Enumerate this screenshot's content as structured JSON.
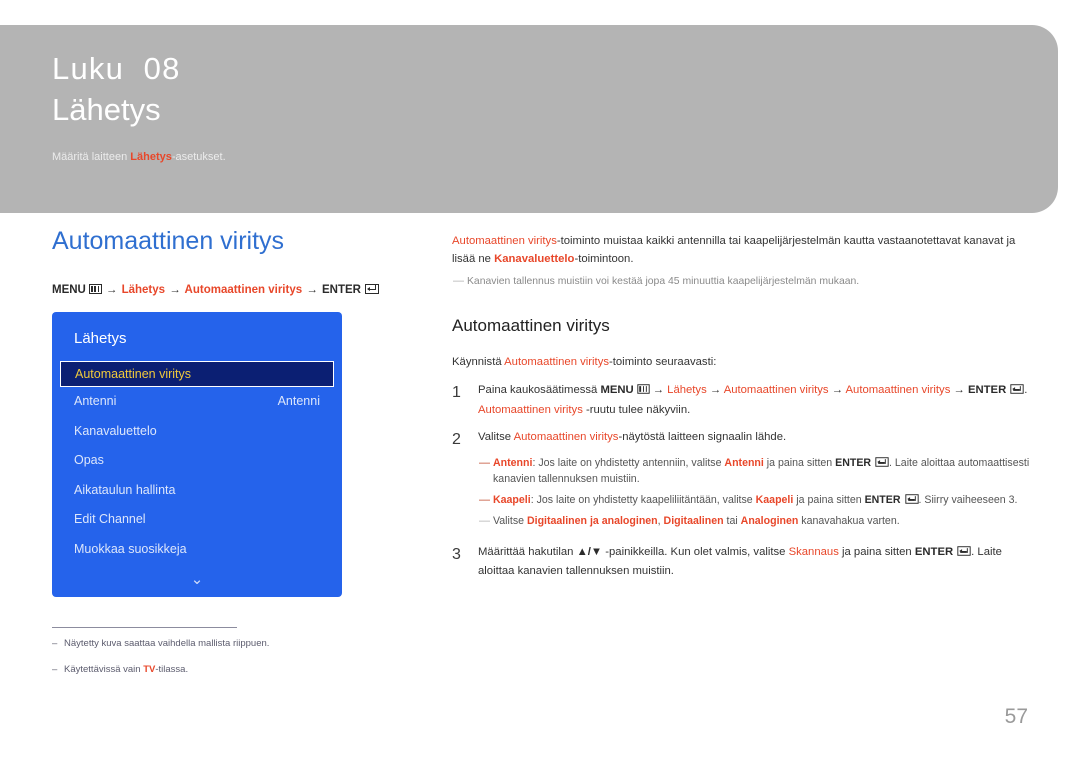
{
  "chapter": {
    "kicker": "Luku  08",
    "title": "Lähetys",
    "sub_pre": "Määritä laitteen ",
    "sub_hl": "Lähetys",
    "sub_post": "-asetukset."
  },
  "left": {
    "section_title": "Automaattinen viritys",
    "menu_path": {
      "menu_label": "MENU",
      "menu_icon": "menu-grid-icon",
      "arrow": "→",
      "item1": "Lähetys",
      "item2": "Automaattinen viritys",
      "enter_label": "ENTER",
      "enter_icon": "enter-key-icon"
    },
    "tv_menu": {
      "title": "Lähetys",
      "rows": [
        {
          "label": "Automaattinen viritys",
          "value": "",
          "selected": true
        },
        {
          "label": "Antenni",
          "value": "Antenni",
          "selected": false
        },
        {
          "label": "Kanavaluettelo",
          "value": "",
          "selected": false
        },
        {
          "label": "Opas",
          "value": "",
          "selected": false
        },
        {
          "label": "Aikataulun hallinta",
          "value": "",
          "selected": false
        },
        {
          "label": "Edit Channel",
          "value": "",
          "selected": false
        },
        {
          "label": "Muokkaa suosikkeja",
          "value": "",
          "selected": false
        }
      ],
      "chevron": "chevron-down-icon",
      "chevron_glyph": "⌄"
    },
    "footnotes": [
      {
        "dash": "–",
        "pre": "Näytetty kuva saattaa vaihdella mallista riippuen.",
        "hl": "",
        "post": ""
      },
      {
        "dash": "–",
        "pre": "Käytettävissä vain ",
        "hl": "TV",
        "post": "-tilassa."
      }
    ]
  },
  "right": {
    "intro": {
      "hl1": "Automaattinen viritys",
      "t1": "-toiminto muistaa kaikki antennilla tai kaapelijärjestelmän kautta vastaanotettavat kanavat ja lisää ne ",
      "hl2": "Kanavaluettelo",
      "t2": "-toimintoon."
    },
    "intro_note": {
      "dash": "―",
      "text": "Kanavien tallennus muistiin voi kestää jopa 45 minuuttia kaapelijärjestelmän mukaan."
    },
    "sub_head": "Automaattinen viritys",
    "lead": {
      "pre": "Käynnistä ",
      "hl": "Automaattinen viritys",
      "post": "-toiminto seuraavasti:"
    },
    "steps": [
      {
        "num": "1",
        "l1_a": "Paina kaukosäätimessä ",
        "l1_menu": "MENU",
        "l1_arrow": "→",
        "l1_b": "Lähetys",
        "l1_c": "Automaattinen viritys",
        "l1_d": "Automaattinen viritys",
        "l1_enter": "ENTER",
        "l1_dot": ".",
        "l2_hl": "Automaattinen viritys",
        "l2_rest": " -ruutu tulee näkyviin."
      },
      {
        "num": "2",
        "text_pre": "Valitse ",
        "text_hl": "Automaattinen viritys",
        "text_post": "-näytöstä laitteen signaalin lähde.",
        "substeps": [
          {
            "dash": "―",
            "hl": "Antenni",
            "a": ": Jos laite on yhdistetty antenniin, valitse ",
            "b": "Antenni",
            "c": " ja paina sitten ",
            "enter": "ENTER",
            "d": ". Laite aloittaa automaattisesti kanavien tallennuksen muistiin."
          },
          {
            "dash": "―",
            "hl": "Kaapeli",
            "a": ": Jos laite on yhdistetty kaapeliliitäntään, valitse ",
            "b": "Kaapeli",
            "c": " ja paina sitten ",
            "enter": "ENTER",
            "d": ". Siirry vaiheeseen 3."
          },
          {
            "dash": "―",
            "grey": true,
            "pre": "Valitse ",
            "o1": "Digitaalinen ja analoginen",
            "sep1": ", ",
            "o2": "Digitaalinen",
            "sep2": " tai ",
            "o3": "Analoginen",
            "post": " kanavahakua varten."
          }
        ]
      },
      {
        "num": "3",
        "t_a": "Määrittää hakutilan ",
        "t_keys": "▲/▼",
        "t_b": " -painikkeilla. Kun olet valmis, valitse ",
        "t_hl": "Skannaus",
        "t_c": " ja paina sitten ",
        "t_enter": "ENTER",
        "t_d": ". Laite aloittaa kanavien tallennuksen muistiin."
      }
    ]
  },
  "page_number": "57",
  "colors": {
    "accent_red": "#e8472a",
    "section_blue": "#2f6fd0",
    "tv_menu_blue": "#2563eb",
    "tv_selected_navy": "#0b1f73",
    "tv_selected_text": "#f0c93c",
    "band_grey": "#b4b4b4"
  }
}
